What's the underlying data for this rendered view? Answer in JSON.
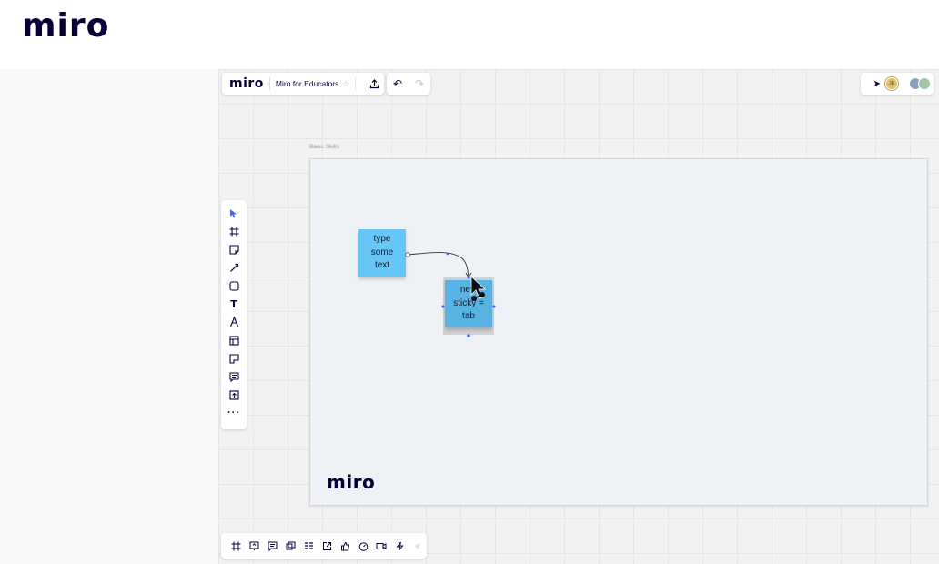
{
  "header": {
    "logo": "miro"
  },
  "board": {
    "logo": "miro",
    "title": "Miro for Educators",
    "star_icon": "star-icon",
    "share_icon": "upload-icon",
    "undo_icon": "undo-icon",
    "redo_icon": "redo-icon",
    "collaborators": [
      {
        "icon": "cursor-follow-icon"
      },
      {
        "initials": "JE",
        "color": "#e3c16f"
      },
      {
        "color": "#8aa0c0"
      },
      {
        "color": "#9fc7a6"
      }
    ]
  },
  "frame": {
    "label": "Basic Skills",
    "logo": "miro"
  },
  "stickies": [
    {
      "text": "type some text",
      "color": "#67c6f5"
    },
    {
      "text": "new sticky = tab",
      "color": "#58b3e3"
    }
  ],
  "toolbar": [
    "select-icon",
    "frame-icon",
    "sticky-note-icon",
    "pen-icon",
    "shape-icon",
    "text-icon",
    "draw-icon",
    "template-icon",
    "card-icon",
    "comment-icon",
    "upload-icon",
    "more-icon"
  ],
  "bottom_bar": [
    "frames-icon",
    "presentation-icon",
    "comments-icon",
    "video-icon",
    "kanban-icon",
    "share-screen-icon",
    "reactions-icon",
    "timer-icon",
    "video-chat-icon",
    "power-icon",
    "collapse-icon"
  ],
  "colors": {
    "accent": "#4262ff",
    "text": "#050038"
  }
}
